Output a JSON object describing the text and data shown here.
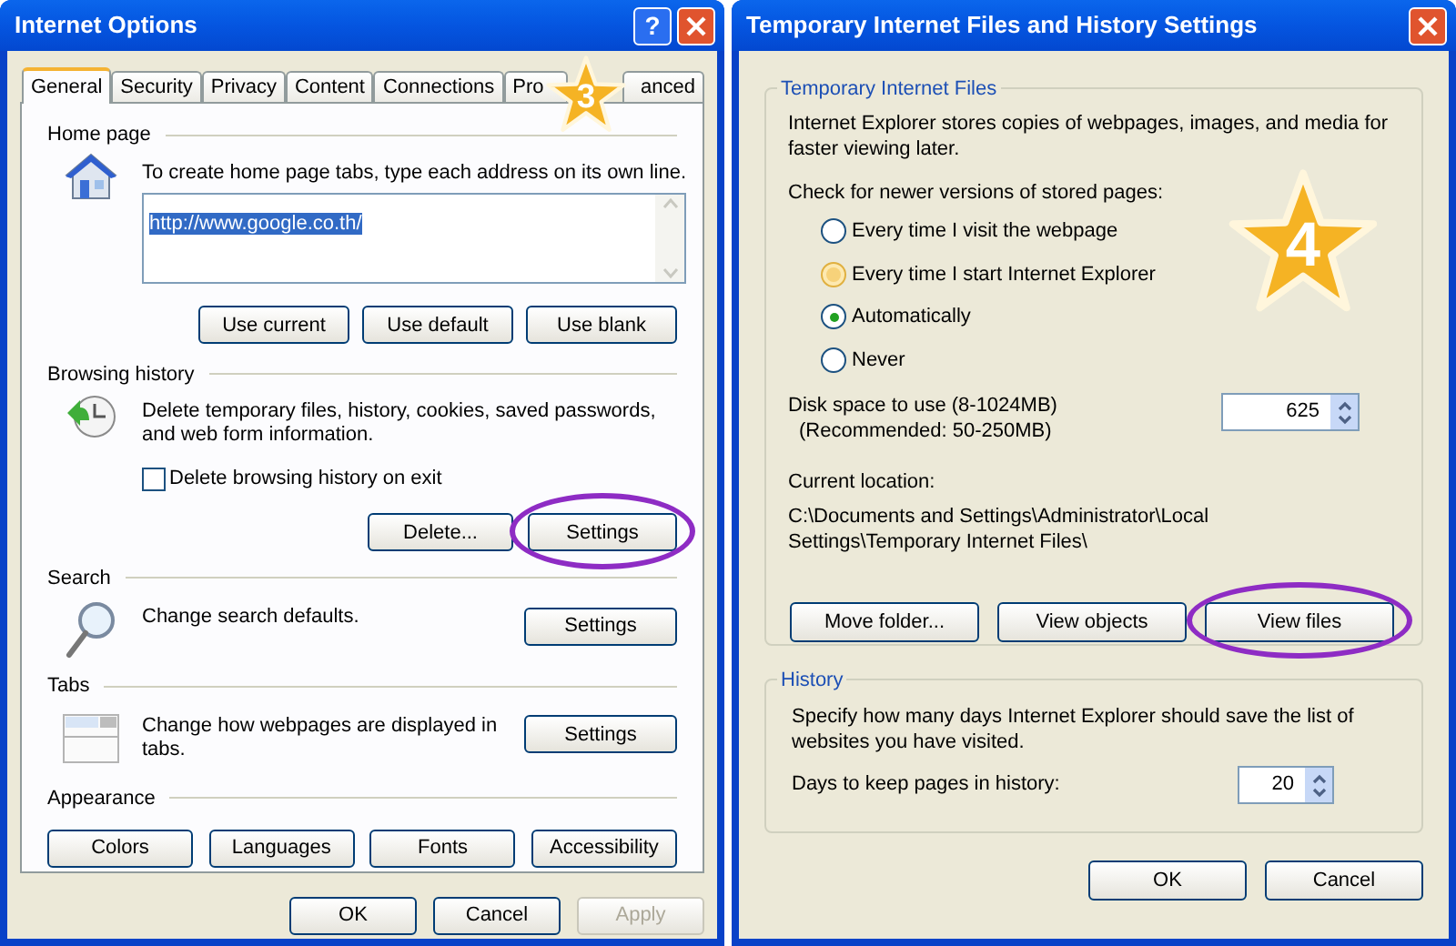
{
  "internet_options": {
    "title": "Internet Options",
    "help_button": "?",
    "step": "3",
    "tabs": [
      {
        "label": "General",
        "selected": true
      },
      {
        "label": "Security",
        "selected": false
      },
      {
        "label": "Privacy",
        "selected": false
      },
      {
        "label": "Content",
        "selected": false
      },
      {
        "label": "Connections",
        "selected": false
      },
      {
        "label": "Pro",
        "selected": false
      },
      {
        "label": "anced",
        "selected": false
      }
    ],
    "home_page": {
      "heading": "Home page",
      "description": "To create home page tabs, type each address on its own line.",
      "address": "http://www.google.co.th/",
      "buttons": [
        {
          "label": "Use current",
          "highlighted": false
        },
        {
          "label": "Use default",
          "highlighted": false
        },
        {
          "label": "Use blank",
          "highlighted": false
        }
      ]
    },
    "browsing_history": {
      "heading": "Browsing history",
      "description": "Delete temporary files, history, cookies, saved passwords, and web form information.",
      "checkbox": {
        "label": "Delete browsing history on exit",
        "checked": false
      },
      "buttons": [
        {
          "label": "Delete...",
          "highlighted": false
        },
        {
          "label": "Settings",
          "highlighted": true
        }
      ]
    },
    "search": {
      "heading": "Search",
      "description": "Change search defaults.",
      "buttons": [
        {
          "label": "Settings",
          "highlighted": false
        }
      ]
    },
    "tabs_section": {
      "heading": "Tabs",
      "description": "Change how webpages are displayed in tabs.",
      "buttons": [
        {
          "label": "Settings",
          "highlighted": false
        }
      ]
    },
    "appearance": {
      "heading": "Appearance",
      "buttons": [
        {
          "label": "Colors",
          "highlighted": false
        },
        {
          "label": "Languages",
          "highlighted": false
        },
        {
          "label": "Fonts",
          "highlighted": false
        },
        {
          "label": "Accessibility",
          "highlighted": false
        }
      ]
    },
    "footer_buttons": [
      {
        "label": "OK",
        "disabled": false
      },
      {
        "label": "Cancel",
        "disabled": false
      },
      {
        "label": "Apply",
        "disabled": true
      }
    ]
  },
  "temp_files_settings": {
    "title": "Temporary Internet Files and History Settings",
    "step": "4",
    "temporary_files": {
      "heading": "Temporary Internet Files",
      "description": "Internet Explorer stores copies of webpages, images, and media for faster viewing later.",
      "check_label": "Check for newer versions of stored pages:",
      "options": [
        {
          "label": "Every time I visit the webpage",
          "selected": false,
          "hovered": false
        },
        {
          "label": "Every time I start Internet Explorer",
          "selected": false,
          "hovered": true
        },
        {
          "label": "Automatically",
          "selected": true,
          "hovered": false
        },
        {
          "label": "Never",
          "selected": false,
          "hovered": false
        }
      ],
      "disk_label": "Disk space to use (8-1024MB)",
      "disk_recommended": "(Recommended: 50-250MB)",
      "disk_value": "625",
      "location_label": "Current location:",
      "location_path": "C:\\Documents and Settings\\Administrator\\Local Settings\\Temporary Internet Files\\",
      "buttons": [
        {
          "label": "Move folder...",
          "highlighted": false
        },
        {
          "label": "View objects",
          "highlighted": false
        },
        {
          "label": "View files",
          "highlighted": true
        }
      ]
    },
    "history": {
      "heading": "History",
      "description": "Specify how many days Internet Explorer should save the list of websites you have visited.",
      "days_label": "Days to keep pages in history:",
      "days_value": "20"
    },
    "footer_buttons": [
      {
        "label": "OK",
        "disabled": false
      },
      {
        "label": "Cancel",
        "disabled": false
      }
    ]
  }
}
